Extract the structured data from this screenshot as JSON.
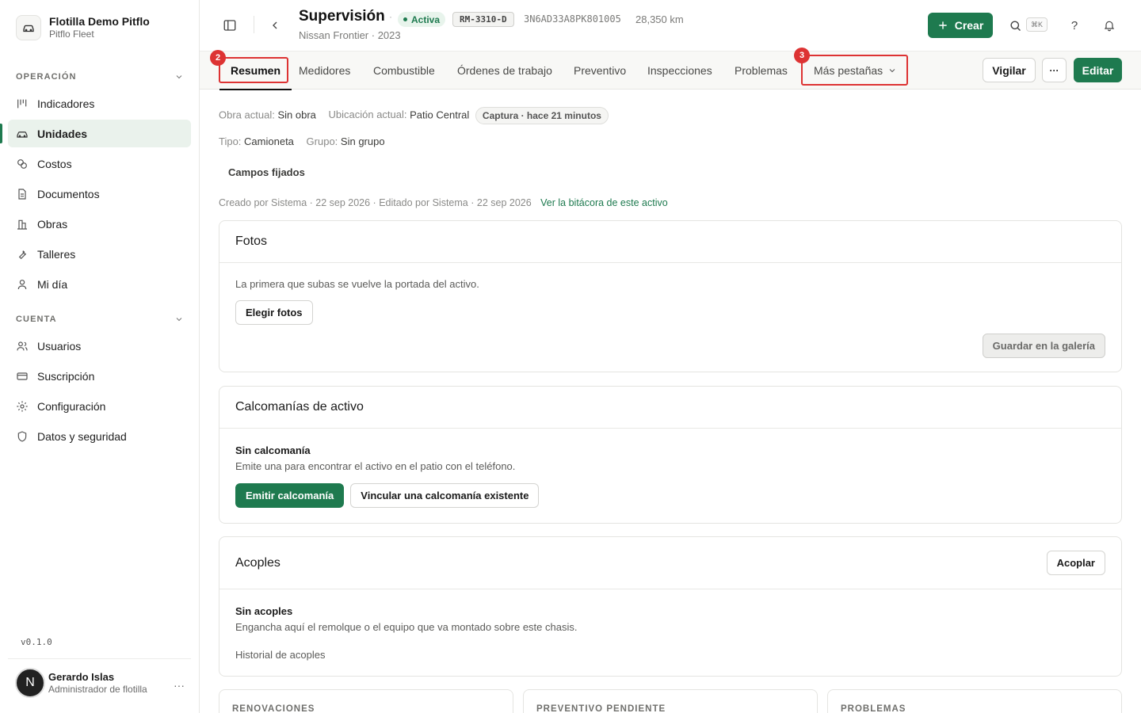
{
  "org": {
    "name": "Flotilla Demo Pitflo",
    "sub": "Pitflo Fleet"
  },
  "sidebar": {
    "section_operacion": "OPERACIÓN",
    "operacion_items": [
      {
        "label": "Indicadores",
        "icon": "chart-icon"
      },
      {
        "label": "Unidades",
        "icon": "car-icon",
        "active": true
      },
      {
        "label": "Costos",
        "icon": "coins-icon"
      },
      {
        "label": "Documentos",
        "icon": "document-icon"
      },
      {
        "label": "Obras",
        "icon": "building-icon"
      },
      {
        "label": "Talleres",
        "icon": "wrench-icon"
      },
      {
        "label": "Mi día",
        "icon": "person-icon"
      }
    ],
    "section_cuenta": "CUENTA",
    "cuenta_items": [
      {
        "label": "Usuarios",
        "icon": "users-icon"
      },
      {
        "label": "Suscripción",
        "icon": "card-icon"
      },
      {
        "label": "Configuración",
        "icon": "gear-icon"
      },
      {
        "label": "Datos y seguridad",
        "icon": "shield-icon"
      }
    ],
    "version": "v0.1.0"
  },
  "user": {
    "initial": "N",
    "name": "Gerardo Islas",
    "role": "Administrador de flotilla",
    "more": "···"
  },
  "header": {
    "title": "Supervisión",
    "separator": "·",
    "status": "Activa",
    "plate": "RM-3310-D",
    "vin": "3N6AD33A8PK801005",
    "km": "28,350 km",
    "subtitle": "Nissan Frontier · 2023",
    "create_label": "Crear",
    "kbd": "⌘K",
    "help": "?"
  },
  "tabs": {
    "items": [
      "Resumen",
      "Medidores",
      "Combustible",
      "Órdenes de trabajo",
      "Preventivo",
      "Inspecciones",
      "Problemas"
    ],
    "more": "Más pestañas",
    "marker_resumen": "2",
    "marker_more": "3",
    "watch": "Vigilar",
    "overflow": "···",
    "edit": "Editar"
  },
  "meta": {
    "obra_label": "Obra actual:",
    "obra_value": "Sin obra",
    "ubic_label": "Ubicación actual:",
    "ubic_value": "Patio Central",
    "capture": "Captura · hace 21 minutos",
    "tipo_label": "Tipo:",
    "tipo_value": "Camioneta",
    "grupo_label": "Grupo:",
    "grupo_value": "Sin grupo",
    "pinned": "Campos fijados",
    "log": "Creado por Sistema · 22 sep 2026 · Editado por Sistema · 22 sep 2026",
    "log_link": "Ver la bitácora de este activo"
  },
  "fotos": {
    "title": "Fotos",
    "hint": "La primera que subas se vuelve la portada del activo.",
    "choose": "Elegir fotos",
    "save": "Guardar en la galería"
  },
  "calcomanias": {
    "title": "Calcomanías de activo",
    "empty_title": "Sin calcomanía",
    "empty_desc": "Emite una para encontrar el activo en el patio con el teléfono.",
    "emit": "Emitir calcomanía",
    "link": "Vincular una calcomanía existente"
  },
  "acoples": {
    "title": "Acoples",
    "action": "Acoplar",
    "empty_title": "Sin acoples",
    "empty_desc": "Engancha aquí el remolque o el equipo que va montado sobre este chasis.",
    "history": "Historial de acoples"
  },
  "bottom_cards": [
    "RENOVACIONES",
    "PREVENTIVO PENDIENTE",
    "PROBLEMAS"
  ],
  "colors": {
    "accent": "#1e7a4f",
    "highlight": "#d33333"
  }
}
